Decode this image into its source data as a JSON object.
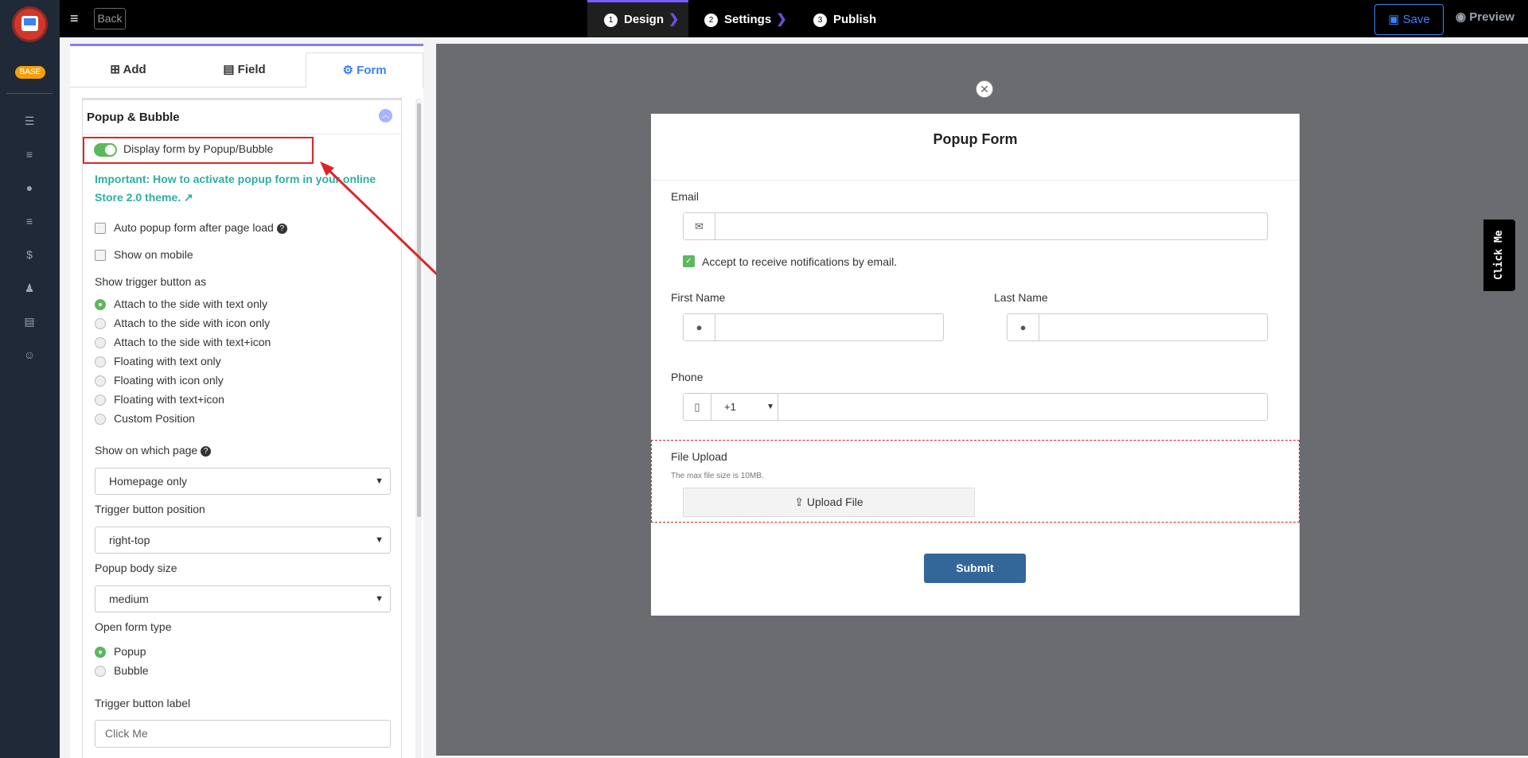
{
  "header": {
    "back_label": "Back",
    "steps": [
      {
        "num": "1",
        "label": "Design"
      },
      {
        "num": "2",
        "label": "Settings"
      },
      {
        "num": "3",
        "label": "Publish"
      }
    ],
    "save_label": "Save",
    "preview_label": "Preview"
  },
  "sidebar": {
    "badge": "BASE",
    "icons": [
      "list-icon",
      "bars-icon",
      "user-icon",
      "menu-icon",
      "dollar-icon",
      "users-icon",
      "file-icon",
      "smile-icon"
    ]
  },
  "panel": {
    "tabs": [
      {
        "label": "Add"
      },
      {
        "label": "Field"
      },
      {
        "label": "Form"
      }
    ],
    "section_title": "Popup & Bubble",
    "toggle_label": "Display form by Popup/Bubble",
    "link_text": "Important: How to activate popup form in your online Store 2.0 theme.",
    "auto_popup_label": "Auto popup form after page load",
    "mobile_label": "Show on mobile",
    "trigger_heading": "Show trigger button as",
    "trigger_options": [
      "Attach to the side with text only",
      "Attach to the side with icon only",
      "Attach to the side with text+icon",
      "Floating with text only",
      "Floating with icon only",
      "Floating with text+icon",
      "Custom Position"
    ],
    "page_label": "Show on which page",
    "page_value": "Homepage only",
    "position_label": "Trigger button position",
    "position_value": "right-top",
    "size_label": "Popup body size",
    "size_value": "medium",
    "open_type_label": "Open form type",
    "open_type_options": [
      "Popup",
      "Bubble"
    ],
    "trigger_label_heading": "Trigger button label",
    "trigger_label_value": "Click Me"
  },
  "form": {
    "title": "Popup Form",
    "email_label": "Email",
    "accept_label": "Accept to receive notifications by email.",
    "first_name_label": "First Name",
    "last_name_label": "Last Name",
    "phone_label": "Phone",
    "phone_code": "+1",
    "file_upload_label": "File Upload",
    "file_hint": "The max file size is 10MB.",
    "upload_button": "Upload File",
    "submit_label": "Submit"
  },
  "trigger_tab_label": "Click Me",
  "colors": {
    "accent": "#3b82f6",
    "highlight": "#dc2626",
    "toggle_on": "#5cb85c",
    "submit": "#336699",
    "link": "#2dafa2"
  }
}
